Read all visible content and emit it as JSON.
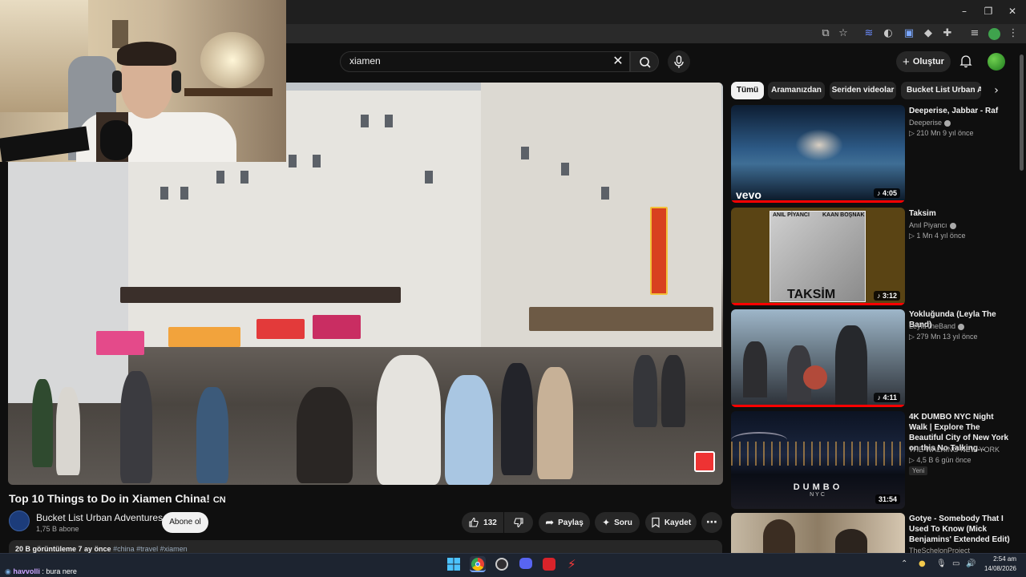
{
  "search": {
    "query": "xiamen"
  },
  "header": {
    "create_label": "Oluştur"
  },
  "video": {
    "title": "Top 10 Things to Do in Xiamen China!",
    "title_suffix": "CN",
    "channel": "Bucket List Urban Adventures",
    "subscribers": "1,75 B abone",
    "subscribe_label": "Abone ol",
    "likes": "132",
    "share_label": "Paylaş",
    "ask_label": "Soru",
    "save_label": "Kaydet",
    "description_stats": "20 B görüntüleme  7 ay önce",
    "description_tags": "#china #travel #xiamen"
  },
  "chips": [
    "Tümü",
    "Aramanızdan",
    "Seriden videolar",
    "Bucket List Urban Adventures"
  ],
  "recommendations": [
    {
      "title": "Deeperise, Jabbar - Raf",
      "channel": "Deeperise",
      "verified": true,
      "meta": "▷ 210 Mn   9 yıl önce",
      "duration": "♪ 4:05",
      "thumb_label": "vevo",
      "progress": 1.0
    },
    {
      "title": "Taksim",
      "channel": "Anıl Piyancı",
      "verified": true,
      "meta": "▷ 1 Mn   4 yıl önce",
      "duration": "♪ 3:12",
      "thumb_label": "TAKSİM",
      "thumb_top_left": "ANIL PİYANCI",
      "thumb_top_right": "KAAN BOŞNAK",
      "progress": 1.0
    },
    {
      "title": "Yokluğunda (Leyla The Band)",
      "channel": "LeylaTheBand",
      "verified": true,
      "meta": "▷ 279 Mn   13 yıl önce",
      "duration": "♪ 4:11",
      "progress": 1.0
    },
    {
      "title": "4K DUMBO NYC Night Walk | Explore The Beautiful City of New York on this No Talking...",
      "channel": "THE WALKING NEW YORK",
      "verified": false,
      "meta": "▷ 4,5 B   6 gün önce",
      "badge": "Yeni",
      "duration": "31:54",
      "thumb_label": "DUMBO",
      "thumb_sublabel": "NYC",
      "progress": 0
    },
    {
      "title": "Gotye - Somebody That I Used To Know (Mick Benjamins' Extended Edit)",
      "channel": "TheSchelonProject",
      "verified": false,
      "meta": "",
      "duration": "",
      "progress": 0
    }
  ],
  "chat": {
    "user": "havvolli",
    "message": " : bura nere"
  },
  "tray": {
    "time": "2:54 am",
    "date": "14/08/2026"
  },
  "colors": {
    "accent": "#ff0000",
    "background": "#0f0f0f",
    "surface": "#272727"
  }
}
